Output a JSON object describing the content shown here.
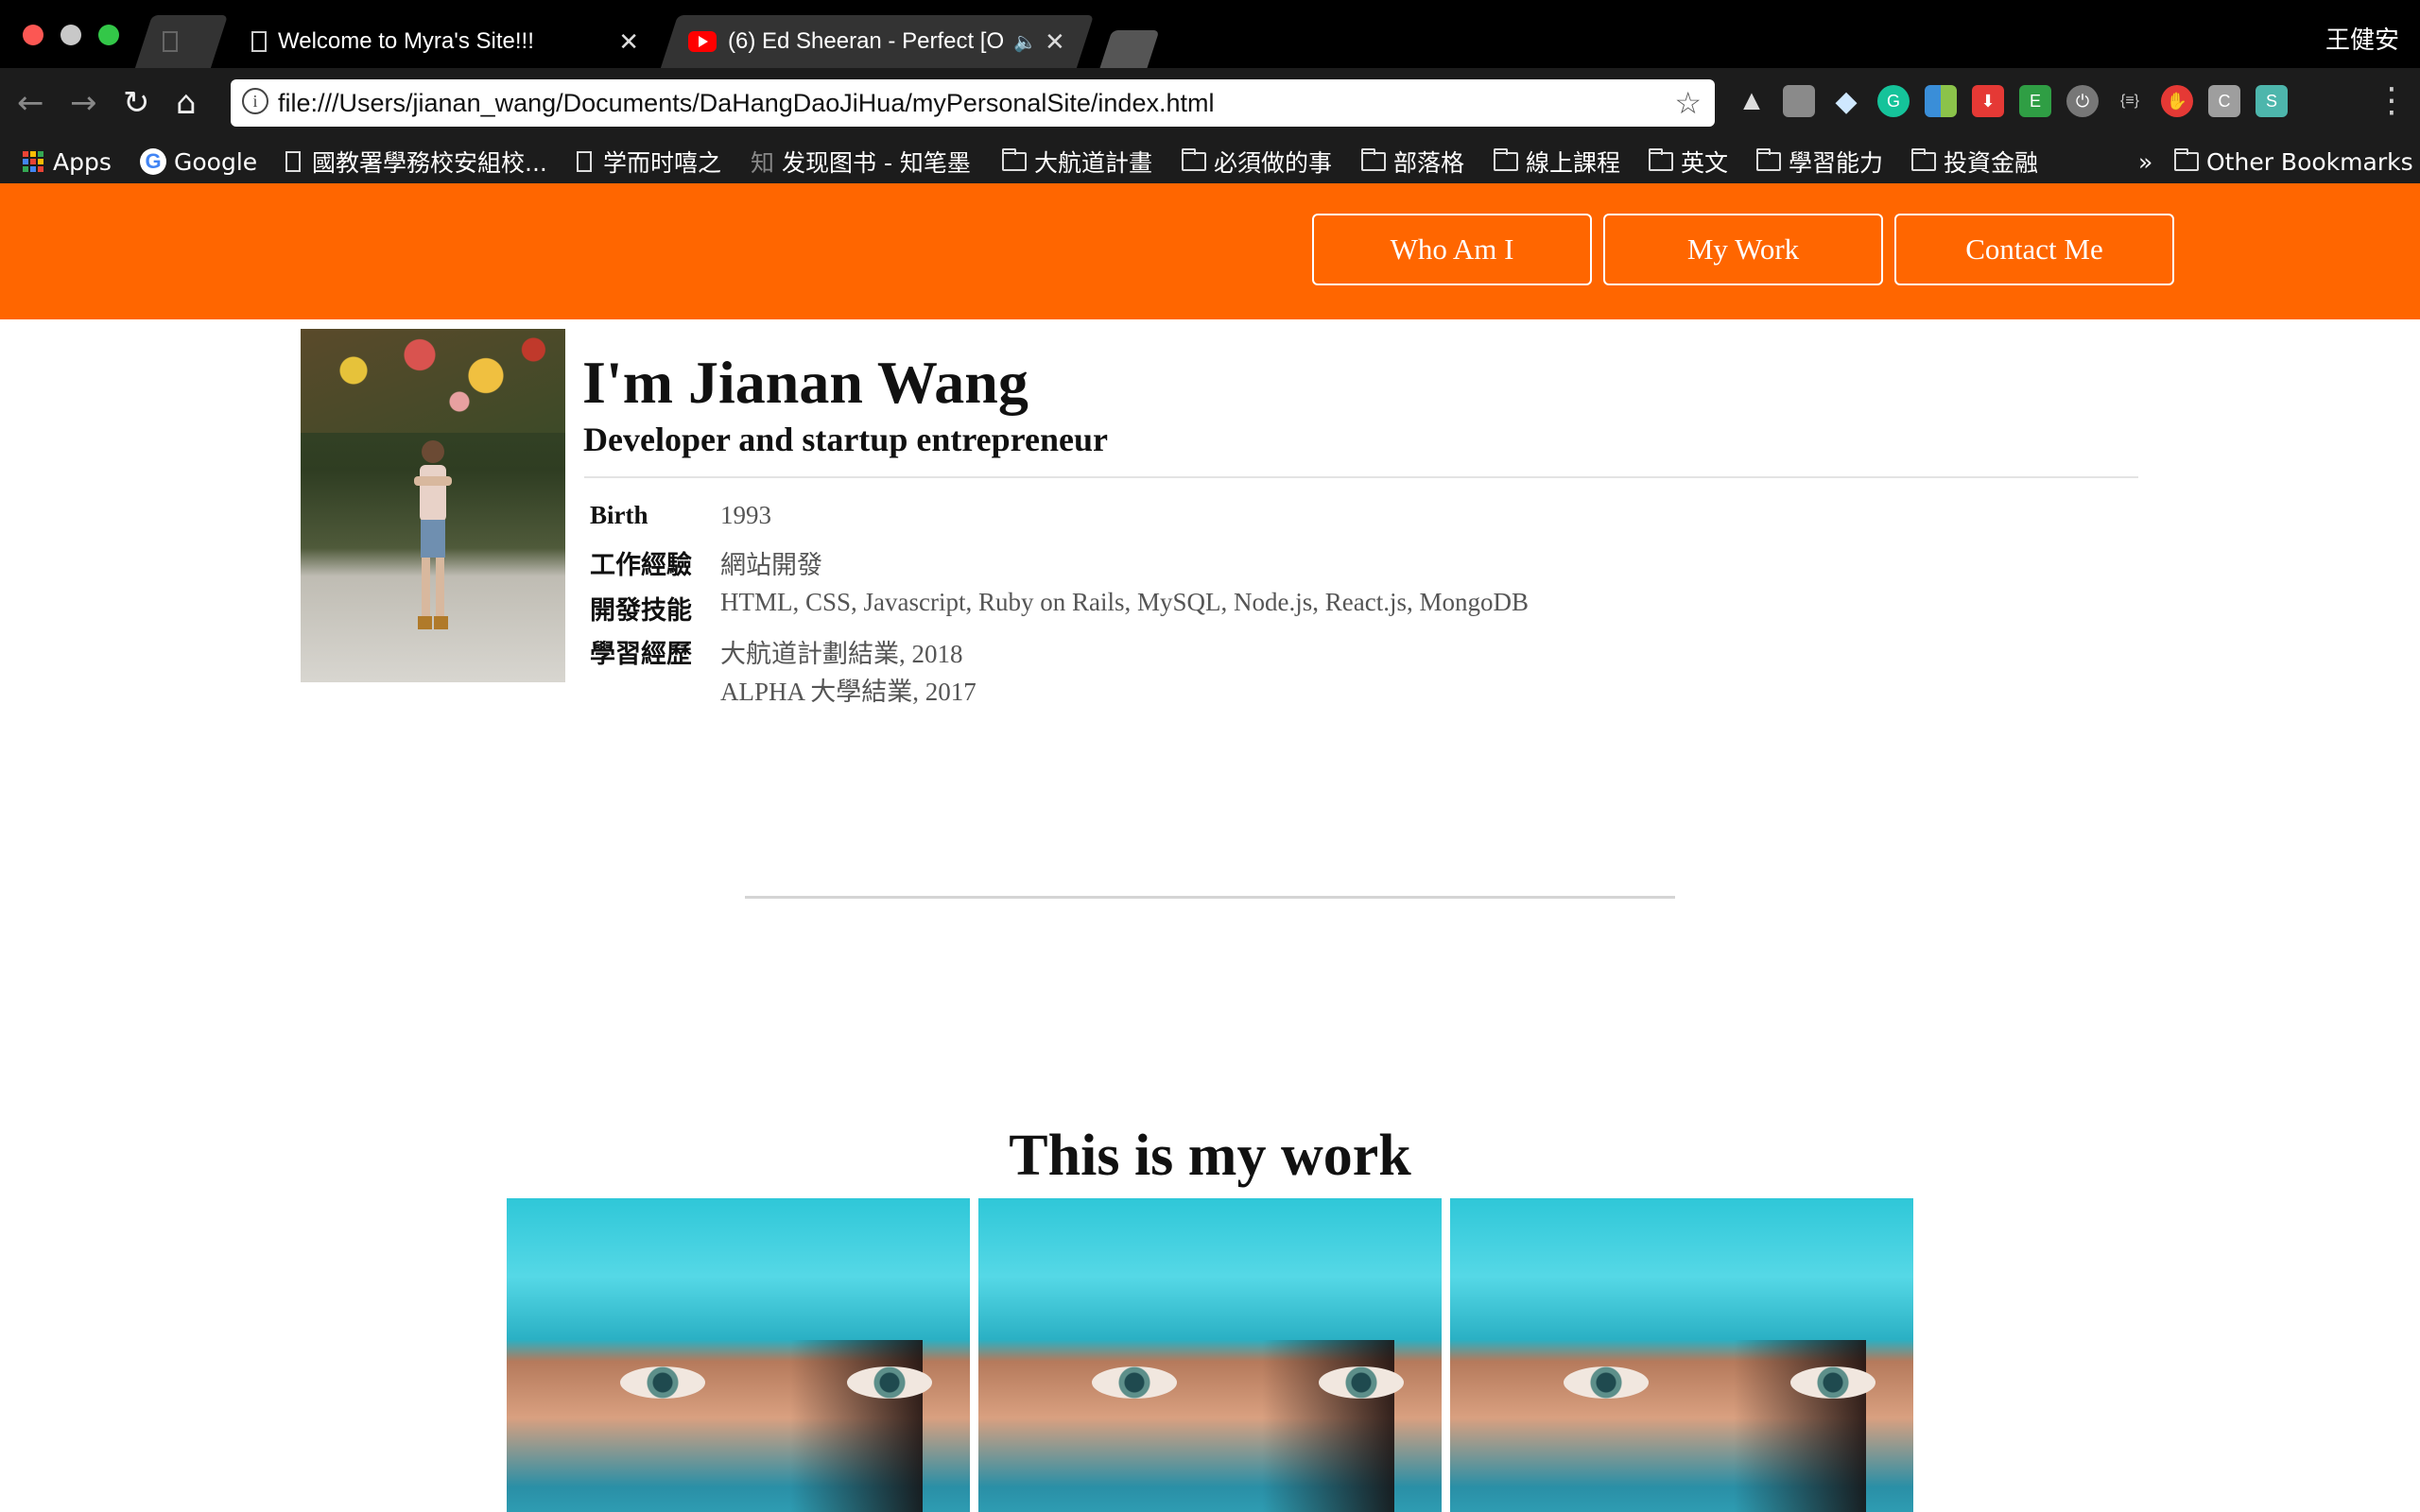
{
  "browser": {
    "tabs": [
      {
        "title": "",
        "state": "inactive"
      },
      {
        "title": "Welcome to Myra's Site!!!",
        "state": "active"
      },
      {
        "title": "(6) Ed Sheeran - Perfect [O",
        "state": "inactive",
        "audio": true
      }
    ],
    "user_name": "王健安",
    "address": "file:///Users/jianan_wang/Documents/DaHangDaoJiHua/myPersonalSite/index.html",
    "bookmarks": [
      {
        "label": "Apps",
        "icon": "apps-grid-icon"
      },
      {
        "label": "Google",
        "icon": "google-icon"
      },
      {
        "label": "國教署學務校安組校...",
        "icon": "page-icon"
      },
      {
        "label": "学而时嘻之",
        "icon": "page-icon"
      },
      {
        "label": "发现图书 - 知笔墨",
        "icon": "zhi-icon"
      },
      {
        "label": "大航道計畫",
        "icon": "folder-icon"
      },
      {
        "label": "必須做的事",
        "icon": "folder-icon"
      },
      {
        "label": "部落格",
        "icon": "folder-icon"
      },
      {
        "label": "線上課程",
        "icon": "folder-icon"
      },
      {
        "label": "英文",
        "icon": "folder-icon"
      },
      {
        "label": "學習能力",
        "icon": "folder-icon"
      },
      {
        "label": "投資金融",
        "icon": "folder-icon"
      }
    ],
    "bookmarks_overflow": "»",
    "other_bookmarks": "Other Bookmarks",
    "zhi_glyph": "知"
  },
  "colors": {
    "accent": "#ff6600",
    "chrome_bg": "#000000",
    "toolbar_bg": "#1c1c1c"
  },
  "nav": {
    "who": "Who Am I",
    "work": "My Work",
    "contact": "Contact Me"
  },
  "profile": {
    "title": "I'm Jianan Wang",
    "subtitle": "Developer and startup entrepreneur",
    "rows": [
      {
        "key": "Birth",
        "value": "1993"
      },
      {
        "key": "工作經驗",
        "value": "網站開發"
      },
      {
        "key": "開發技能",
        "value": "HTML, CSS, Javascript, Ruby on Rails, MySQL, Node.js, React.js, MongoDB"
      },
      {
        "key": "學習經歷",
        "value": "大航道計劃結業, 2018",
        "value2": "ALPHA 大學結業, 2017"
      }
    ]
  },
  "work": {
    "title": "This is my work"
  }
}
